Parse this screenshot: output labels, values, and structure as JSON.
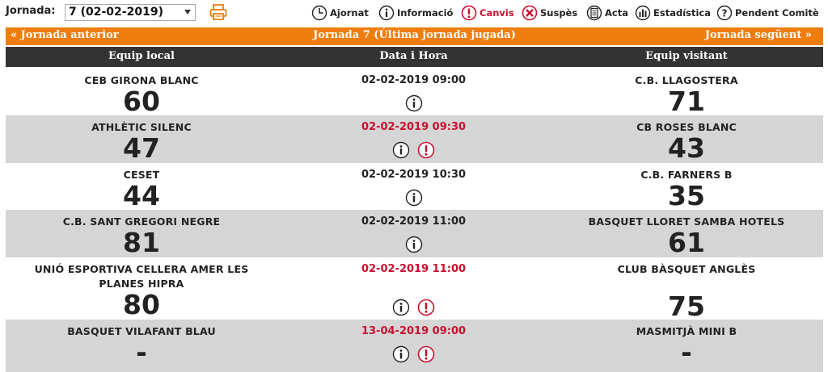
{
  "toolbar": {
    "jornada_label": "Jornada:",
    "jornada_selected": "7 (02-02-2019)",
    "legend": [
      {
        "icon": "clock-icon",
        "label": "Ajornat"
      },
      {
        "icon": "info-icon",
        "label": "Informació"
      },
      {
        "icon": "alert-icon",
        "label": "Canvis"
      },
      {
        "icon": "cross-icon",
        "label": "Suspès"
      },
      {
        "icon": "document-icon",
        "label": "Acta"
      },
      {
        "icon": "stats-icon",
        "label": "Estadística"
      },
      {
        "icon": "question-icon",
        "label": "Pendent Comitè"
      }
    ]
  },
  "nav": {
    "prev": "«  Jornada anterior",
    "title": "Jornada 7 (Última jornada jugada)",
    "next": "Jornada següent  »"
  },
  "table": {
    "headers": {
      "home": "Equip local",
      "date": "Data i Hora",
      "away": "Equip visitant"
    },
    "matches": [
      {
        "home": "CEB GIRONA BLANC",
        "home_score": "60",
        "datetime": "02-02-2019 09:00",
        "changed": false,
        "away": "C.B. LLAGOSTERA",
        "away_score": "71"
      },
      {
        "home": "ATHLÈTIC SILENC",
        "home_score": "47",
        "datetime": "02-02-2019 09:30",
        "changed": true,
        "away": "CB ROSES BLANC",
        "away_score": "43"
      },
      {
        "home": "CESET",
        "home_score": "44",
        "datetime": "02-02-2019 10:30",
        "changed": false,
        "away": "C.B. FARNERS B",
        "away_score": "35"
      },
      {
        "home": "C.B. SANT GREGORI NEGRE",
        "home_score": "81",
        "datetime": "02-02-2019 11:00",
        "changed": false,
        "away": "BASQUET LLORET SAMBA HOTELS",
        "away_score": "61"
      },
      {
        "home": "UNIÓ ESPORTIVA CELLERA AMER LES PLANES HIPRA",
        "home_score": "80",
        "datetime": "02-02-2019 11:00",
        "changed": true,
        "away": "CLUB BÀSQUET ANGLÈS",
        "away_score": "75"
      },
      {
        "home": "BASQUET VILAFANT BLAU",
        "home_score": "-",
        "datetime": "13-04-2019 09:00",
        "changed": true,
        "away": "MASMITJÀ MINI B",
        "away_score": "-"
      }
    ]
  },
  "colors": {
    "accent": "#ef7d0e",
    "header_bg": "#333333",
    "alert_red": "#c8102e",
    "alt_row": "#d5d5d5"
  }
}
